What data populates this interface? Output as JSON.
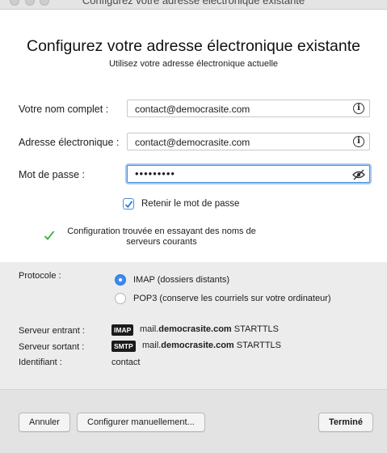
{
  "window": {
    "title": "Configurez votre adresse électronique existante"
  },
  "header": {
    "title": "Configurez votre adresse électronique existante",
    "subtitle": "Utilisez votre adresse électronique actuelle"
  },
  "form": {
    "name_label": "Votre nom complet :",
    "name_value": "contact@democrasite.com",
    "email_label": "Adresse électronique :",
    "email_value": "contact@democrasite.com",
    "password_label": "Mot de passe :",
    "password_value": "•••••••••",
    "remember_label": "Retenir le mot de passe",
    "remember_checked": true
  },
  "status": {
    "found_text": "Configuration trouvée en essayant des noms de serveurs courants"
  },
  "config": {
    "protocol_label": "Protocole :",
    "options": [
      {
        "label": "IMAP (dossiers distants)",
        "selected": true
      },
      {
        "label": "POP3 (conserve les courriels sur votre ordinateur)",
        "selected": false
      }
    ],
    "incoming_label": "Serveur entrant :",
    "incoming_tag": "IMAP",
    "incoming_prefix": "mail.",
    "incoming_domain": "democrasite.com",
    "incoming_security": "STARTTLS",
    "outgoing_label": "Serveur sortant :",
    "outgoing_tag": "SMTP",
    "outgoing_prefix": "mail.",
    "outgoing_domain": "democrasite.com",
    "outgoing_security": "STARTTLS",
    "ident_label": "Identifiant :",
    "ident_value": "contact"
  },
  "buttons": {
    "cancel": "Annuler",
    "manual": "Configurer manuellement...",
    "done": "Terminé"
  },
  "colors": {
    "accent": "#3c8af0",
    "check_green": "#2fb134"
  }
}
